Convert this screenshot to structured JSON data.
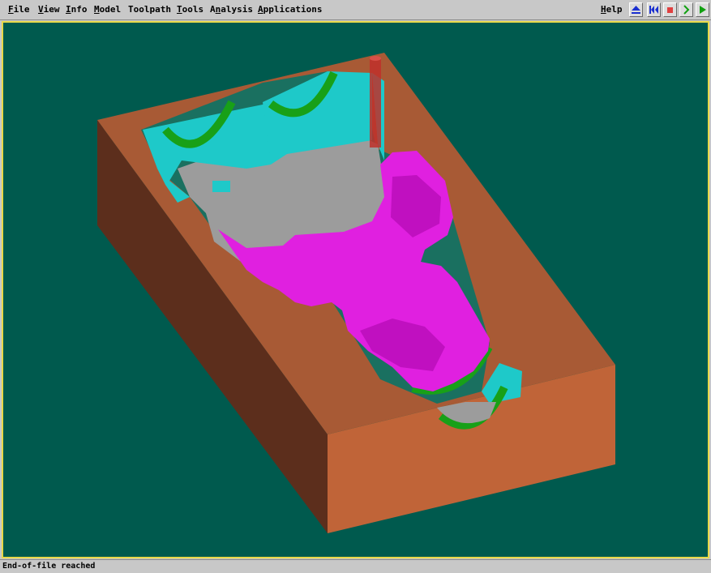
{
  "menubar": {
    "items": [
      {
        "key": "F",
        "rest": "ile"
      },
      {
        "key": "V",
        "rest": "iew"
      },
      {
        "key": "I",
        "rest": "nfo"
      },
      {
        "key": "M",
        "rest": "odel"
      },
      {
        "pre": "Toolpath"
      },
      {
        "key": "T",
        "rest": "ools"
      },
      {
        "pre": "A",
        "key": "n",
        "rest": "alysis"
      },
      {
        "key": "A",
        "rest": "pplications"
      }
    ],
    "help": {
      "key": "H",
      "rest": "elp"
    }
  },
  "toolbar": {
    "buttons": [
      {
        "icon": "eject-icon",
        "color": "#1a2fd0"
      },
      {
        "icon": "rewind-to-start-icon",
        "color": "#1a2fd0"
      },
      {
        "icon": "stop-icon",
        "color": "#e04040"
      },
      {
        "icon": "step-forward-icon",
        "color": "#10a010"
      },
      {
        "icon": "play-icon",
        "color": "#10a010"
      }
    ]
  },
  "viewport": {
    "background": "#005a4e",
    "border_color": "#e8d84a"
  },
  "model_colors": {
    "stock_top": "#a85a35",
    "stock_left": "#5c2e1c",
    "stock_front": "#c06438",
    "floor": "#9c9c9c",
    "cyan_walls": "#1ec9c9",
    "green_fillets": "#18a018",
    "part": "#e020e0",
    "tool": "#c0302a"
  },
  "status": {
    "text": "End-of-file reached"
  }
}
